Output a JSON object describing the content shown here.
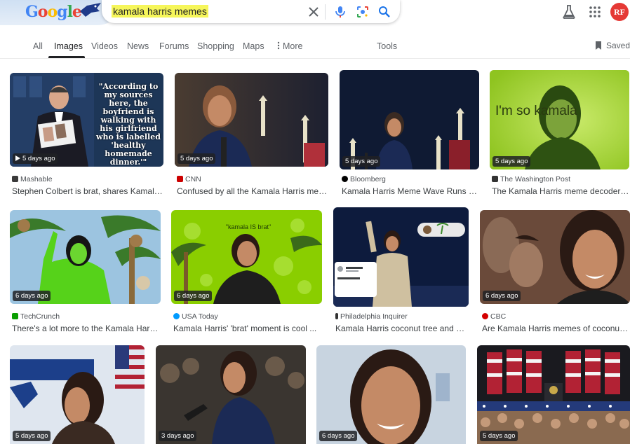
{
  "header": {
    "logo_letters": [
      "G",
      "o",
      "o",
      "g",
      "l",
      "e"
    ],
    "search_query": "kamala harris memes",
    "avatar_text": "RF"
  },
  "tabs": [
    {
      "label": "All"
    },
    {
      "label": "Images",
      "active": true
    },
    {
      "label": "Videos"
    },
    {
      "label": "News"
    },
    {
      "label": "Forums"
    },
    {
      "label": "Shopping"
    },
    {
      "label": "Maps"
    },
    {
      "label": "More"
    }
  ],
  "tools_label": "Tools",
  "saved_label": "Saved",
  "results": [
    {
      "age": "5 days ago",
      "video": true,
      "source": "Mashable",
      "title": "Stephen Colbert is brat, shares Kamala ...",
      "overlay": "\"According to my sources here, the boyfriend is walking with his girlfriend who is labelled 'healthy homemade dinner.'\""
    },
    {
      "age": "5 days ago",
      "source": "CNN",
      "title": "Confused by all the Kamala Harris mem..."
    },
    {
      "age": "5 days ago",
      "source": "Bloomberg",
      "title": "Kamala Harris Meme Wave Runs the..."
    },
    {
      "age": "5 days ago",
      "source": "The Washington Post",
      "title": "The Kamala Harris meme decoders ...",
      "overlay": "I'm so kamala"
    },
    {
      "age": "6 days ago",
      "source": "TechCrunch",
      "title": "There's a lot more to the Kamala Harris ..."
    },
    {
      "age": "6 days ago",
      "source": "USA Today",
      "title": "Kamala Harris' 'brat' moment is cool ...",
      "overlay": "\"kamala IS brat\""
    },
    {
      "age": "",
      "source": "Philadelphia Inquirer",
      "title": "Kamala Harris coconut tree and Ch..."
    },
    {
      "age": "6 days ago",
      "source": "CBC",
      "title": "Are Kamala Harris memes of coconut ..."
    },
    {
      "age": "5 days ago"
    },
    {
      "age": "3 days ago"
    },
    {
      "age": "6 days ago"
    },
    {
      "age": "5 days ago"
    }
  ],
  "colors": {
    "accent_blue": "#1a73e8",
    "brat_green": "#8ace00",
    "mic_blue": "#4285f4",
    "avatar_red": "#e53935"
  }
}
